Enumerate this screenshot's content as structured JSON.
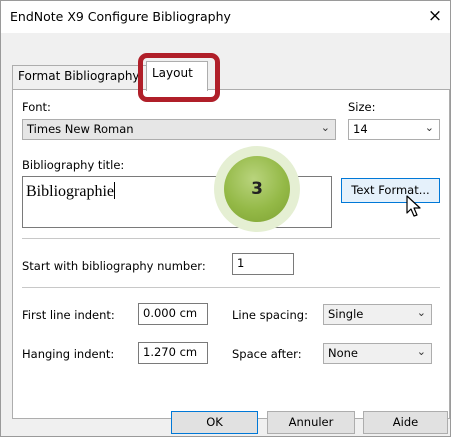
{
  "window": {
    "title": "EndNote X9 Configure Bibliography",
    "close_glyph": "×"
  },
  "tabs": [
    {
      "label": "Format Bibliography",
      "active": false
    },
    {
      "label": "Layout",
      "active": true
    }
  ],
  "font": {
    "label": "Font:",
    "value": "Times New Roman"
  },
  "size": {
    "label": "Size:",
    "value": "14"
  },
  "bibliography_title": {
    "label": "Bibliography title:",
    "value": "Bibliographie"
  },
  "text_format_button": "Text Format...",
  "step_badge": "3",
  "start_number": {
    "label": "Start with bibliography number:",
    "value": "1"
  },
  "first_line_indent": {
    "label": "First line indent:",
    "value": "0.000 cm"
  },
  "hanging_indent": {
    "label": "Hanging indent:",
    "value": "1.270 cm"
  },
  "line_spacing": {
    "label": "Line spacing:",
    "value": "Single"
  },
  "space_after": {
    "label": "Space after:",
    "value": "None"
  },
  "buttons": {
    "ok": "OK",
    "cancel": "Annuler",
    "help": "Aide"
  },
  "colors": {
    "highlight_border": "#b01f29",
    "badge_fill": "#94b947",
    "focus_border": "#0078d7"
  }
}
